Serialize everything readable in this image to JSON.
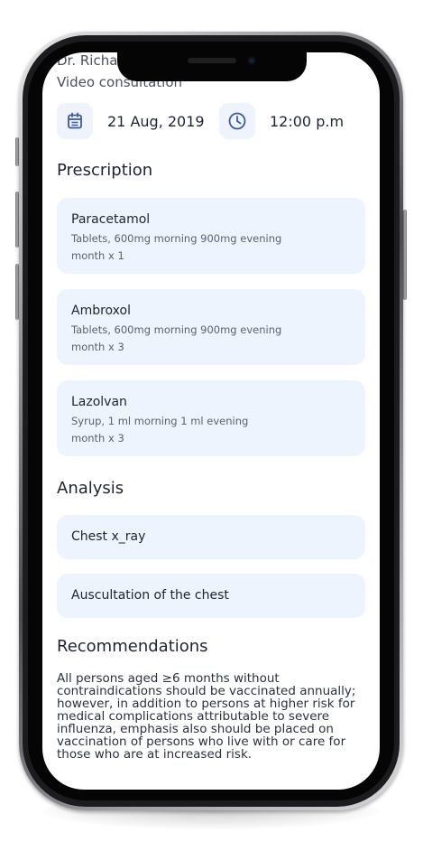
{
  "doctor": {
    "name": "Dr. Richa",
    "consultation_type": "Video consultation"
  },
  "appointment": {
    "date": "21 Aug, 2019",
    "time": "12:00 p.m"
  },
  "icons": {
    "date": "calendar-icon",
    "time": "clock-icon"
  },
  "colors": {
    "accent": "#3d5a9e",
    "card_bg": "#eef4fd",
    "text": "#1d2433"
  },
  "prescription": {
    "title": "Prescription",
    "items": [
      {
        "name": "Paracetamol",
        "dosage": "Tablets, 600mg morning 900mg evening",
        "duration": "month x 1"
      },
      {
        "name": "Ambroxol",
        "dosage": "Tablets, 600mg morning 900mg evening",
        "duration": "month x 3"
      },
      {
        "name": "Lazolvan",
        "dosage": "Syrup, 1 ml morning 1 ml evening",
        "duration": "month x 3"
      }
    ]
  },
  "analysis": {
    "title": "Analysis",
    "items": [
      {
        "name": "Chest x_ray"
      },
      {
        "name": "Auscultation of the chest"
      }
    ]
  },
  "recommendations": {
    "title": "Recommendations",
    "text": "All persons aged ≥6 months without contraindications should be vaccinated annually; however, in addition to persons at higher risk for medical complications attributable to severe influenza, emphasis also should be placed on vaccination of persons who live with or care for those who are at increased risk."
  }
}
